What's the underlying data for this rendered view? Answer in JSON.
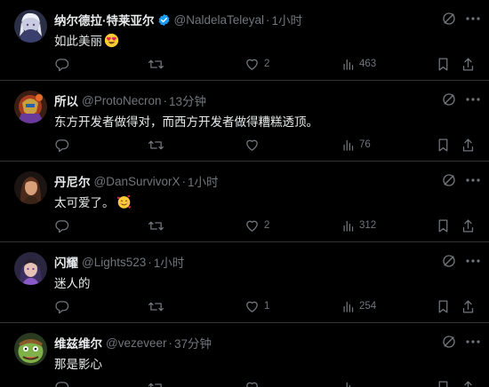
{
  "colors": {
    "background": "#000000",
    "text": "#e7e9ea",
    "muted": "#71767b",
    "divider": "#2f3336",
    "verified": "#1d9bf0"
  },
  "tweets": [
    {
      "name": "纳尔德拉·特莱亚尔",
      "verified": true,
      "handle": "@NaldelaTeleyal",
      "dot": "·",
      "time": "1小时",
      "text": "如此美丽",
      "emoji": "heart-eyes-emoji",
      "reply_count": "",
      "retweet_count": "",
      "like_count": "2",
      "view_count": "463",
      "avatar": "avatar-silver-hair"
    },
    {
      "name": "所以",
      "verified": false,
      "handle": "@ProtoNecron",
      "dot": "·",
      "time": "13分钟",
      "text": "东方开发者做得对，而西方开发者做得糟糕透顶。",
      "emoji": "",
      "reply_count": "",
      "retweet_count": "",
      "like_count": "",
      "view_count": "76",
      "avatar": "avatar-armored-robot"
    },
    {
      "name": "丹尼尔",
      "verified": false,
      "handle": "@DanSurvivorX",
      "dot": "·",
      "time": "1小时",
      "text": "太可爱了。",
      "emoji": "smiling-hearts-emoji",
      "reply_count": "",
      "retweet_count": "",
      "like_count": "2",
      "view_count": "312",
      "avatar": "avatar-woman-portrait"
    },
    {
      "name": "闪耀",
      "verified": false,
      "handle": "@Lights523",
      "dot": "·",
      "time": "1小时",
      "text": "迷人的",
      "emoji": "",
      "reply_count": "",
      "retweet_count": "",
      "like_count": "1",
      "view_count": "254",
      "avatar": "avatar-character-purple"
    },
    {
      "name": "维兹维尔",
      "verified": false,
      "handle": "@vezeveer",
      "dot": "·",
      "time": "37分钟",
      "text": "那是影心",
      "emoji": "",
      "reply_count": "",
      "retweet_count": "",
      "like_count": "",
      "view_count": "",
      "avatar": "avatar-cartoon-ogre"
    }
  ]
}
